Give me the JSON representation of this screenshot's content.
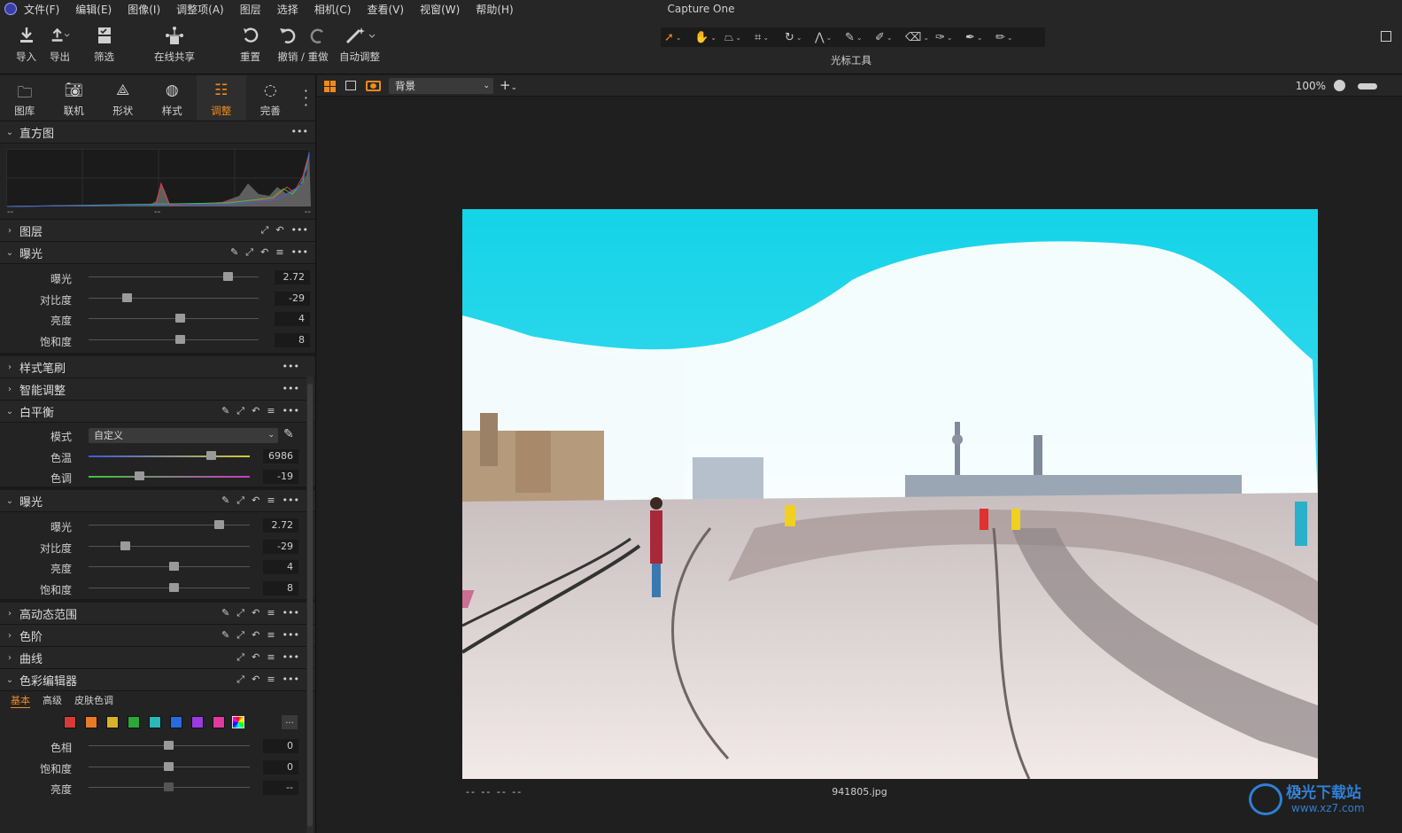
{
  "window_title": "Capture One",
  "menu": [
    "文件(F)",
    "编辑(E)",
    "图像(I)",
    "调整项(A)",
    "图层",
    "选择",
    "相机(C)",
    "查看(V)",
    "视窗(W)",
    "帮助(H)"
  ],
  "toolbar": {
    "import": "导入",
    "export": "导出",
    "filter": "筛选",
    "share": "在线共享",
    "reset": "重置",
    "undo_redo": "撤销 / 重做",
    "auto": "自动调整",
    "cursor_tools": "光标工具"
  },
  "tool_tabs": [
    "图库",
    "联机",
    "形状",
    "样式",
    "调整",
    "完善"
  ],
  "active_tool_tab": "调整",
  "histogram": {
    "title": "直方图",
    "labels": [
      "--",
      "--",
      "--"
    ]
  },
  "sections": {
    "layers": "图层",
    "exposure1": "曝光",
    "style_brush": "样式笔刷",
    "smart_adjust": "智能调整",
    "white_balance": "白平衡",
    "exposure2": "曝光",
    "hdr": "高动态范围",
    "levels": "色阶",
    "curves": "曲线",
    "color_editor": "色彩编辑器"
  },
  "exposure1": [
    {
      "label": "曝光",
      "value": "2.72"
    },
    {
      "label": "对比度",
      "value": "-29"
    },
    {
      "label": "亮度",
      "value": "4"
    },
    {
      "label": "饱和度",
      "value": "8"
    }
  ],
  "white_balance": {
    "mode_label": "模式",
    "mode_value": "自定义",
    "rows": [
      {
        "label": "色温",
        "value": "6986"
      },
      {
        "label": "色调",
        "value": "-19"
      }
    ]
  },
  "exposure2": [
    {
      "label": "曝光",
      "value": "2.72"
    },
    {
      "label": "对比度",
      "value": "-29"
    },
    {
      "label": "亮度",
      "value": "4"
    },
    {
      "label": "饱和度",
      "value": "8"
    }
  ],
  "color_editor": {
    "tabs": [
      "基本",
      "高级",
      "皮肤色调"
    ],
    "more": "...",
    "rows": [
      {
        "label": "色相",
        "value": "0"
      },
      {
        "label": "饱和度",
        "value": "0"
      },
      {
        "label": "亮度",
        "value": "--"
      }
    ],
    "swatches": [
      "#d83a3a",
      "#e87b2a",
      "#d8b22a",
      "#2aa83a",
      "#2ab8b8",
      "#2a6ae0",
      "#9a3ae0",
      "#e03aa0"
    ]
  },
  "viewer": {
    "layer": "背景",
    "zoom": "100%",
    "filename": "941805.jpg",
    "meta": "--   --   --   --"
  },
  "watermark": {
    "name": "极光下载站",
    "url": "www.xz7.com"
  },
  "colors": {
    "accent": "#f08a1c",
    "panel": "#232323",
    "bg": "#1e1e1e"
  }
}
